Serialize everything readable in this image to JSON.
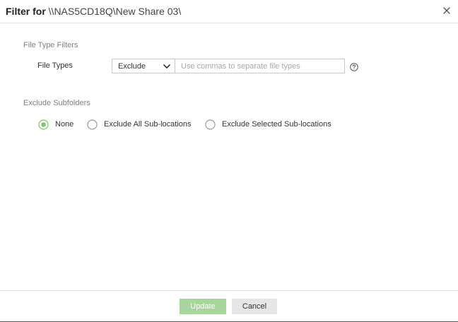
{
  "dialog": {
    "title_prefix": "Filter for",
    "title_path": "\\\\NAS5CD18Q\\New Share 03\\"
  },
  "file_type_filters": {
    "section_label": "File Type Filters",
    "field_label": "File Types",
    "mode_selected": "Exclude",
    "input_value": "",
    "input_placeholder": "Use commas to separate file types"
  },
  "exclude_subfolders": {
    "section_label": "Exclude Subfolders",
    "options": [
      {
        "label": "None",
        "selected": true
      },
      {
        "label": "Exclude All Sub-locations",
        "selected": false
      },
      {
        "label": "Exclude Selected Sub-locations",
        "selected": false
      }
    ]
  },
  "footer": {
    "update_label": "Update",
    "cancel_label": "Cancel"
  },
  "colors": {
    "accent_green": "#7cc56a",
    "update_button_disabled": "#a6d69b",
    "cancel_button": "#e6e6e6"
  },
  "icons": {
    "close": "close-icon",
    "dropdown": "chevron-down-icon",
    "help": "help-icon"
  }
}
